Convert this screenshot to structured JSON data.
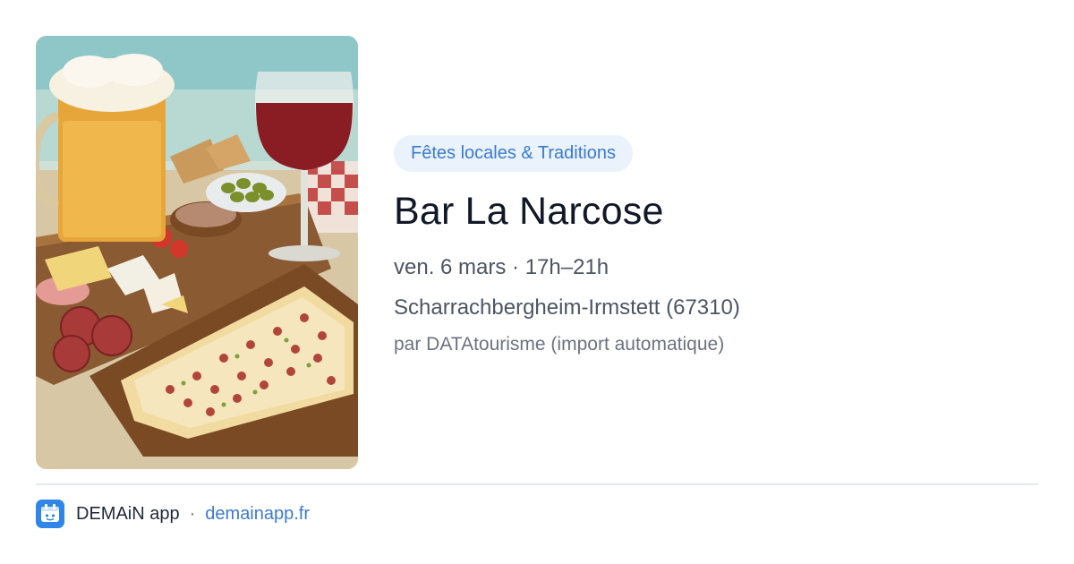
{
  "category": "Fêtes locales & Traditions",
  "title": "Bar La Narcose",
  "datetime": "ven. 6 mars · 17h–21h",
  "location": "Scharrachbergheim-Irmstett (67310)",
  "source": "par DATAtourisme (import automatique)",
  "footer": {
    "app_name": "DEMAiN app",
    "separator": "·",
    "link": "demainapp.fr"
  },
  "colors": {
    "accent": "#3b7bd0",
    "badge_bg": "#eaf2fb",
    "logo_bg": "#2f86e8"
  },
  "icons": {
    "app_logo": "demain-logo-icon"
  }
}
